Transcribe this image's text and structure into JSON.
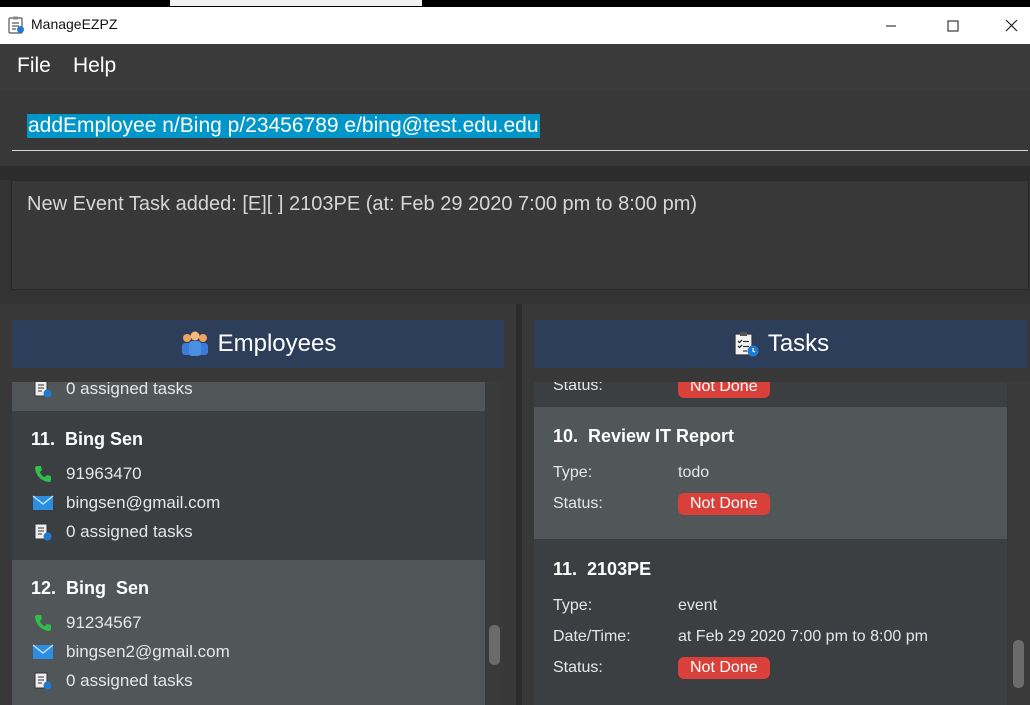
{
  "window": {
    "title": "ManageEZPZ",
    "icon": "task-list-icon",
    "controls": [
      "minimize-icon",
      "maximize-icon",
      "close-icon"
    ]
  },
  "menu": {
    "items": [
      "File",
      "Help"
    ]
  },
  "command": {
    "value": "addEmployee n/Bing p/23456789 e/bing@test.edu.edu"
  },
  "result": {
    "text": "New Event Task added: [E][ ] 2103PE (at: Feb 29 2020 7:00 pm to 8:00 pm)"
  },
  "employees_panel": {
    "title": "Employees",
    "icon": "people-icon",
    "partial_card": {
      "tasks": "0 assigned tasks"
    },
    "cards": [
      {
        "name": "11.  Bing Sen",
        "phone": "91963470",
        "email": "bingsen@gmail.com",
        "tasks": "0 assigned tasks"
      },
      {
        "name": "12.  Bing  Sen",
        "phone": "91234567",
        "email": "bingsen2@gmail.com",
        "tasks": "0 assigned tasks"
      }
    ]
  },
  "tasks_panel": {
    "title": "Tasks",
    "icon": "clipboard-clock-icon",
    "partial_card": {
      "status_label": "Status:",
      "status": "Not Done"
    },
    "cards": [
      {
        "name": "10.  Review IT Report",
        "type_label": "Type:",
        "type": "todo",
        "status_label": "Status:",
        "status": "Not Done"
      },
      {
        "name": "11.  2103PE",
        "type_label": "Type:",
        "type": "event",
        "datetime_label": "Date/Time:",
        "datetime": "at Feb 29 2020 7:00 pm to 8:00 pm",
        "status_label": "Status:",
        "status": "Not Done"
      }
    ]
  },
  "colors": {
    "header_bg": "#2c3e59",
    "selection": "#0096c9",
    "badge": "#d9403a",
    "panel_bg": "#383838"
  }
}
